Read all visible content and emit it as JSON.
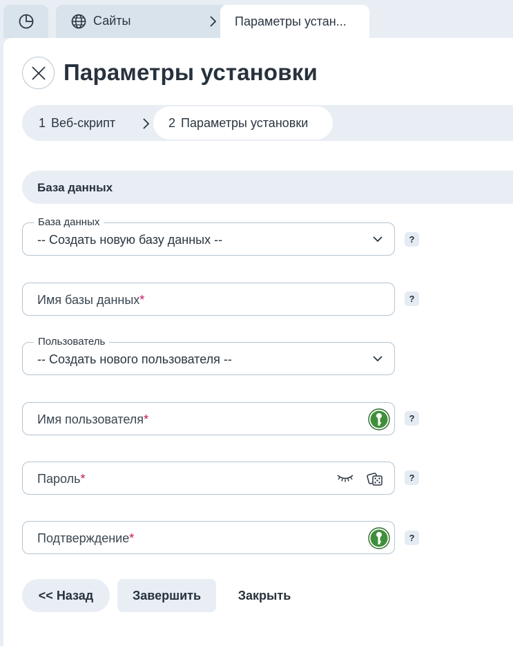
{
  "tabs": {
    "home_icon": "dashboard-pie-icon",
    "sites_label": "Сайты",
    "active_label": "Параметры устан..."
  },
  "page": {
    "title": "Параметры установки"
  },
  "stepper": {
    "steps": [
      {
        "num": "1",
        "label": "Веб-скрипт"
      },
      {
        "num": "2",
        "label": "Параметры установки"
      }
    ]
  },
  "section": {
    "title": "База данных"
  },
  "form": {
    "database_select": {
      "label": "База данных",
      "value": "-- Создать новую базу данных --"
    },
    "db_name": {
      "placeholder": "Имя базы данных",
      "required_mark": "*"
    },
    "user_select": {
      "label": "Пользователь",
      "value": "-- Создать нового пользователя --"
    },
    "user_name": {
      "placeholder": "Имя пользователя",
      "required_mark": "*"
    },
    "password": {
      "placeholder": "Пароль",
      "required_mark": "*"
    },
    "confirm": {
      "placeholder": "Подтверждение",
      "required_mark": "*"
    },
    "help_label": "?"
  },
  "buttons": {
    "back": "<< Назад",
    "finish": "Завершить",
    "close": "Закрыть"
  },
  "colors": {
    "accent_required": "#c2185b",
    "keypass_green": "#3f8f3a"
  }
}
